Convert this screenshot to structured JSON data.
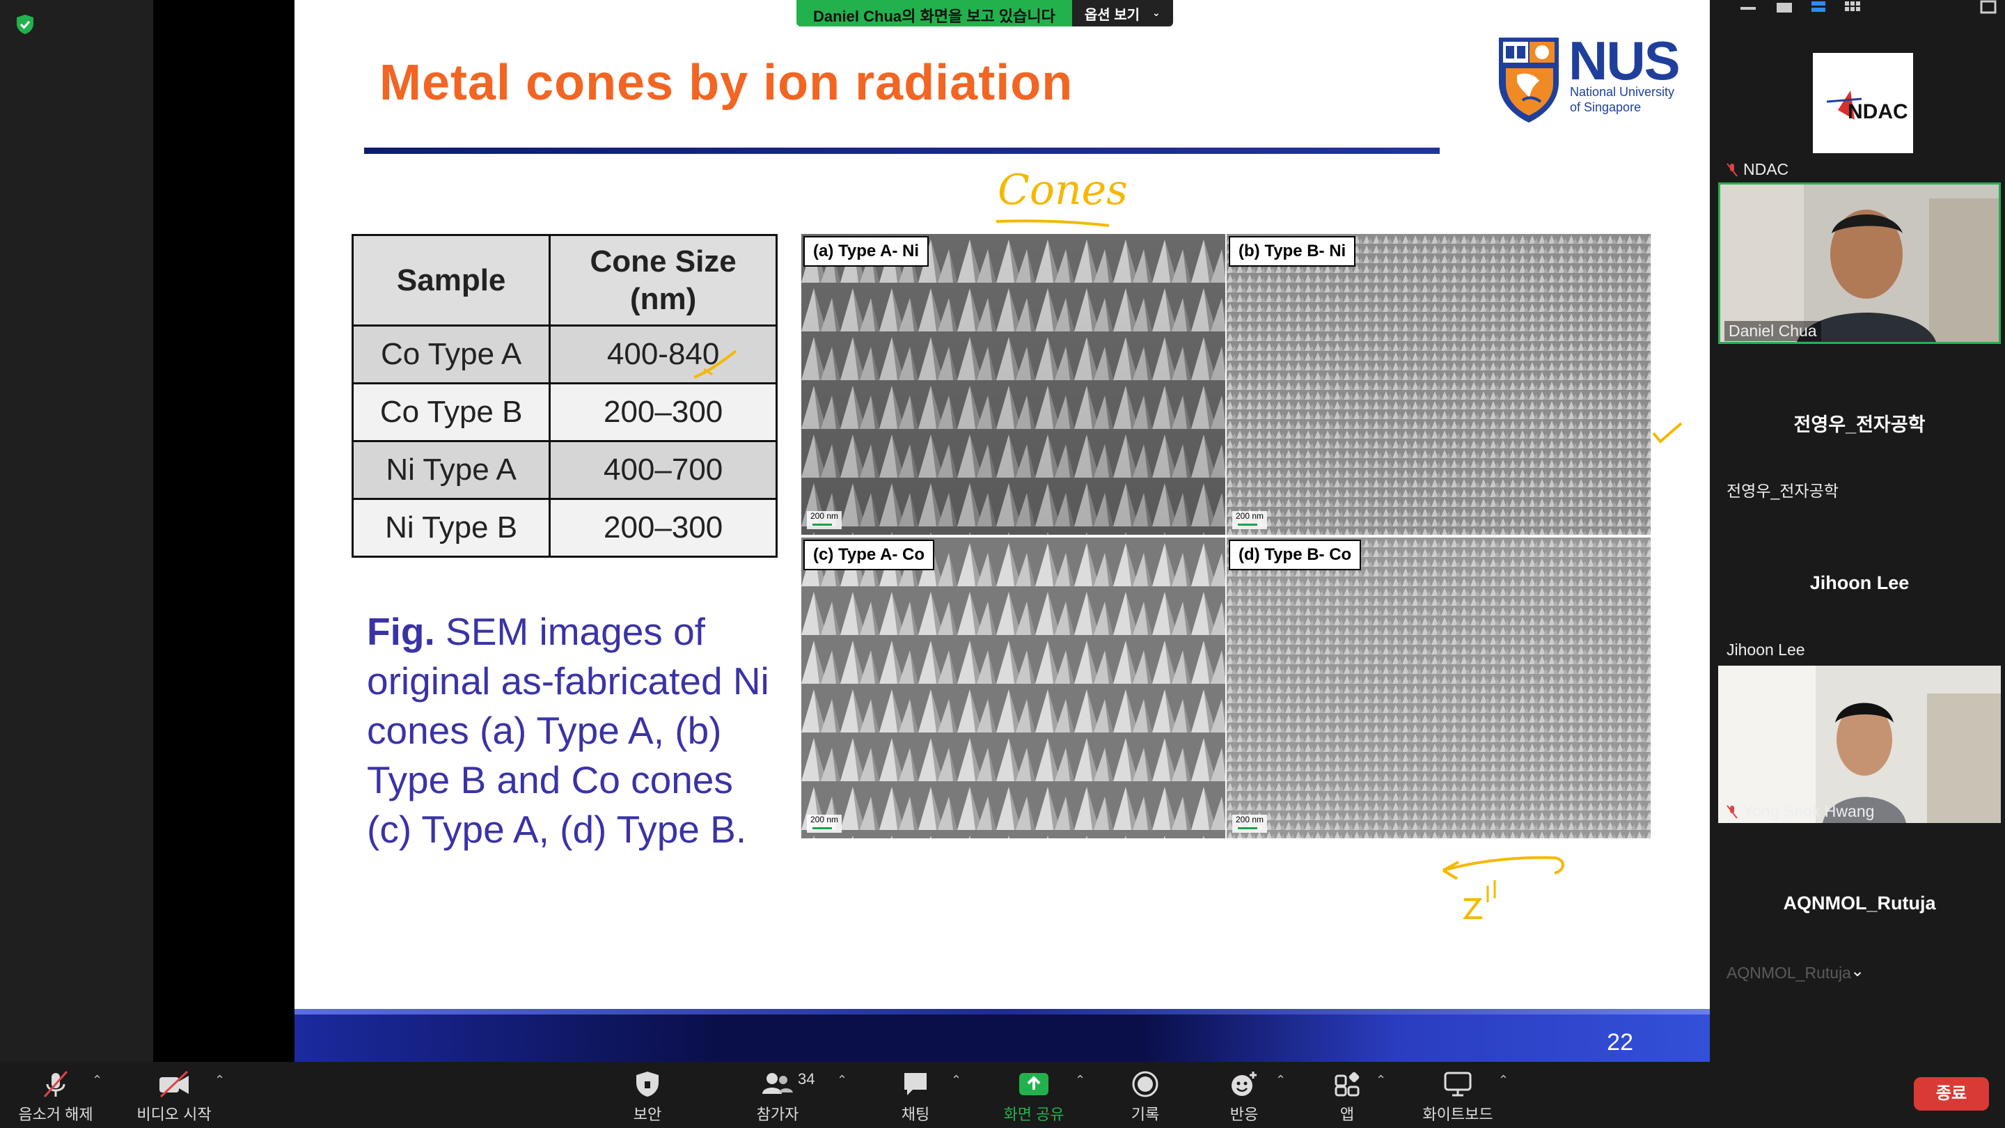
{
  "share_banner": {
    "message": "Daniel Chua의 화면을 보고 있습니다",
    "options_label": "옵션 보기"
  },
  "slide": {
    "title": "Metal cones by ion radiation",
    "logo": {
      "name": "NUS",
      "line1": "National University",
      "line2": "of Singapore"
    },
    "table": {
      "headers": [
        "Sample",
        "Cone Size (nm)"
      ],
      "rows": [
        {
          "sample": "Co Type A",
          "size": "400-840"
        },
        {
          "sample": "Co Type B",
          "size": "200–300"
        },
        {
          "sample": "Ni Type A",
          "size": "400–700"
        },
        {
          "sample": "Ni Type B",
          "size": "200–300"
        }
      ]
    },
    "caption": {
      "lead": "Fig.",
      "body": " SEM images of original as-fabricated Ni cones (a) Type A, (b) Type B and Co cones (c) Type A, (d) Type B."
    },
    "sem_panels": [
      {
        "label": "(a) Type A- Ni",
        "scale": "200 nm"
      },
      {
        "label": "(b) Type B- Ni",
        "scale": "200 nm"
      },
      {
        "label": "(c) Type A- Co",
        "scale": "200 nm"
      },
      {
        "label": "(d) Type B- Co",
        "scale": "200 nm"
      }
    ],
    "page_number": "22",
    "annotation_text": "Cones"
  },
  "participants": [
    {
      "name": "NDAC",
      "type": "logo",
      "logo_text": "NDAC",
      "muted": true
    },
    {
      "name": "Daniel Chua",
      "type": "video",
      "muted": false
    },
    {
      "name": "전영우_전자공학",
      "type": "name",
      "center_name": "전영우_전자공학"
    },
    {
      "name": "Jihoon Lee",
      "type": "name",
      "center_name": "Jihoon Lee"
    },
    {
      "name": "Yong Seok Hwang",
      "type": "video",
      "muted": true
    },
    {
      "name": "AQNMOL_Rutuja",
      "type": "name",
      "center_name": "AQNMOL_Rutuja",
      "footer_name": "AQNMOL_Rutuja"
    }
  ],
  "toolbar": {
    "mute": "음소거 해제",
    "video": "비디오 시작",
    "security": "보안",
    "participants": "참가자",
    "participants_count": "34",
    "chat": "채팅",
    "share": "화면 공유",
    "record": "기록",
    "reactions": "반응",
    "apps": "앱",
    "whiteboard": "화이트보드",
    "end": "종료"
  },
  "colors": {
    "title_orange": "#f26522",
    "caption_purple": "#3a33a6",
    "nus_blue": "#1f3f9c",
    "share_green": "#23b14d",
    "end_red": "#d93a36",
    "annotation_yellow": "#f5b800"
  }
}
